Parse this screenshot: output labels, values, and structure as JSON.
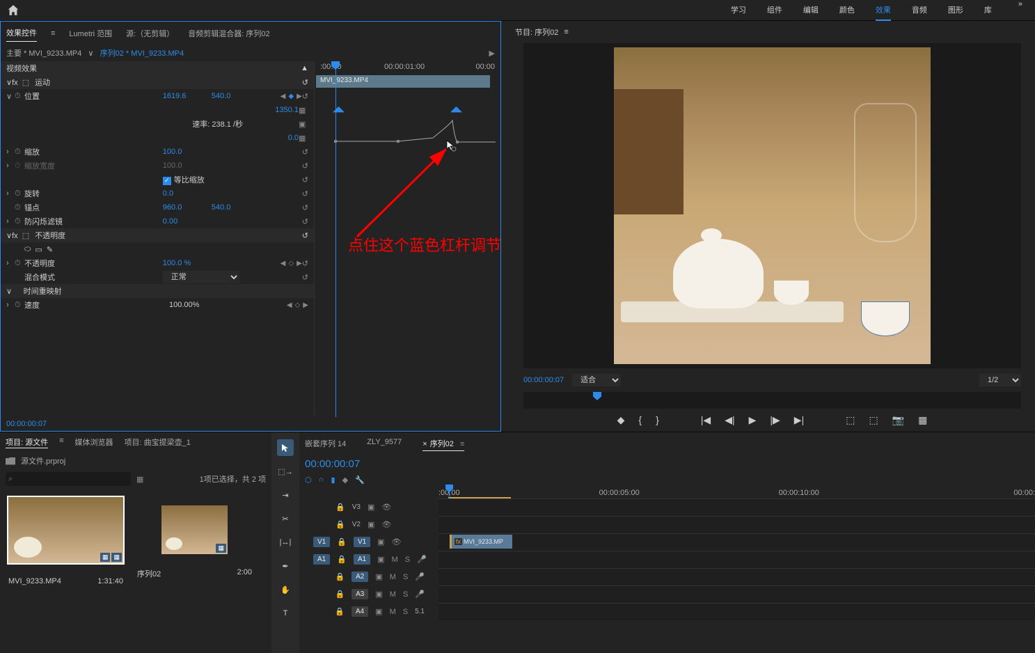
{
  "topbar": {
    "tabs": [
      "学习",
      "组件",
      "编辑",
      "颜色",
      "效果",
      "音频",
      "图形",
      "库"
    ],
    "active_index": 4
  },
  "effect_panel": {
    "tabs": {
      "controls": "效果控件",
      "lumetri": "Lumetri 范围",
      "source": "源:（无剪辑）",
      "mixer": "音频剪辑混合器: 序列02"
    },
    "breadcrumb_main": "主要 * MVI_9233.MP4",
    "breadcrumb_seq": "序列02 * MVI_9233.MP4",
    "section_video": "视频效果",
    "section_motion": "运动",
    "section_opacity": "不透明度",
    "section_timeremap": "时间重映射",
    "clip_name": "MVI_9233.MP4",
    "props": {
      "position": {
        "name": "位置",
        "x": "1619.6",
        "y": "540.0"
      },
      "position_max": "1350.1",
      "position_min": "0.0",
      "rate": "速率: 238.1 /秒",
      "scale": {
        "name": "缩放",
        "val": "100.0"
      },
      "scale_width": {
        "name": "缩放宽度",
        "val": "100.0"
      },
      "uniform": "等比缩放",
      "rotation": {
        "name": "旋转",
        "val": "0.0"
      },
      "anchor": {
        "name": "锚点",
        "x": "960.0",
        "y": "540.0"
      },
      "antiflicker": {
        "name": "防闪烁滤镜",
        "val": "0.00"
      },
      "opacity": {
        "name": "不透明度",
        "val": "100.0 %"
      },
      "blend": {
        "name": "混合模式",
        "val": "正常"
      },
      "speed": {
        "name": "速度",
        "val": "100.00%"
      }
    },
    "ruler": {
      "t0": ":00:00",
      "t1": "00:00:01:00",
      "t2": "00:00"
    },
    "timecode": "00:00:00:07"
  },
  "annotation": "点住这个蓝色杠杆调节",
  "program": {
    "title": "节目: 序列02",
    "timecode": "00:00:00:07",
    "fit": "适合",
    "zoom": "1/2"
  },
  "project": {
    "tabs": {
      "main": "项目: 源文件",
      "browser": "媒体浏览器",
      "other": "项目: 曲宝提梁壶_1"
    },
    "path": "源文件.prproj",
    "search_placeholder": "⌕",
    "status": "1项已选择，共 2 项",
    "items": [
      {
        "name": "MVI_9233.MP4",
        "duration": "1:31:40"
      },
      {
        "name": "序列02",
        "duration": "2:00"
      }
    ]
  },
  "timeline": {
    "tabs": [
      {
        "label": "嵌套序列 14",
        "close": false
      },
      {
        "label": "ZLY_9577",
        "close": false
      },
      {
        "label": "序列02",
        "close": true
      }
    ],
    "active_tab": 2,
    "timecode": "00:00:00:07",
    "ruler": [
      ":00:00",
      "00:00:05:00",
      "00:00:10:00",
      "00:00:"
    ],
    "tracks": {
      "v3": "V3",
      "v2": "V2",
      "v1": "V1",
      "a1": "A1",
      "a2": "A2",
      "a3": "A3",
      "a4": "A4"
    },
    "clip_name": "MVI_9233.MP",
    "clip_fx": "fx",
    "mixer_label": "5.1"
  }
}
